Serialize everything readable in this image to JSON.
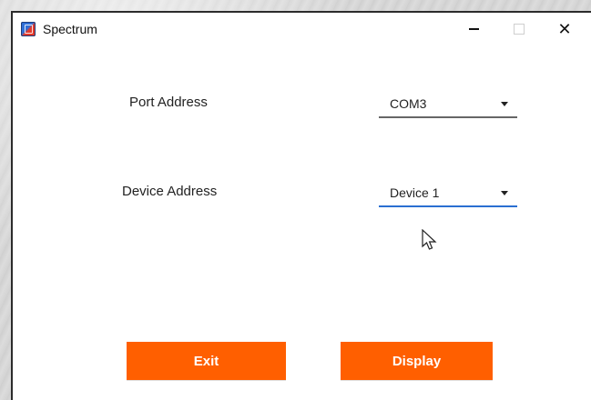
{
  "window": {
    "title": "Spectrum",
    "icon": "spectrum-app-icon"
  },
  "controls": {
    "minimize": "–",
    "maximize": "□",
    "close": "✕"
  },
  "form": {
    "port_address_label": "Port Address",
    "port_address_value": "COM3",
    "device_address_label": "Device Address",
    "device_address_value": "Device 1"
  },
  "buttons": {
    "exit_label": "Exit",
    "display_label": "Display"
  },
  "colors": {
    "accent_orange": "#ff5f00",
    "focus_blue": "#2a6fd1"
  }
}
